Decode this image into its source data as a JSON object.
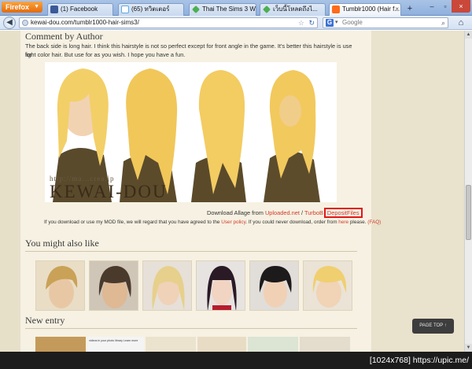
{
  "browser": {
    "menu_button": "Firefox",
    "tabs": [
      {
        "label": "(1) Facebook",
        "icon": "facebook-icon"
      },
      {
        "label": "(65) ทวิตเตอร์",
        "icon": "twitter-icon"
      },
      {
        "label": "Thai The Sims 3 W...",
        "icon": "sims-icon"
      },
      {
        "label": "เว็บนี้โหลดถึงไ...",
        "icon": "sims-icon"
      },
      {
        "label": "Tumblr1000 (Hair f...",
        "icon": "tumblr-icon",
        "active": true
      }
    ],
    "url": "kewai-dou.com/tumblr1000-hair-sims3/",
    "search_placeholder": "Google",
    "search_engine_letter": "G"
  },
  "article": {
    "heading": "Comment by Author",
    "body_line1": "The back side is long hair. I think this hairstyle is not so perfect except for front angle in the game. It's better this hairstyle is use for",
    "body_line2": "light color hair. But use for as you wish. I hope you have a fun.",
    "image_watermark_small": "http://ma...crea.jp",
    "image_watermark_big": "KEWAI-DOU",
    "download_prefix": "Download Allage from ",
    "download_link1": "Uploaded.net",
    "download_sep": " / ",
    "download_link2": "TurboB",
    "download_link3": "DepositFiles",
    "policy_prefix": "If you download or use my MOD file, we will regard that you have agreed to the ",
    "policy_link": "User policy",
    "policy_mid": ". If you could never download, order from ",
    "policy_here": "here",
    "policy_suffix": " please. ",
    "policy_faq": "(FAQ)"
  },
  "related": {
    "heading": "You might also like",
    "thumbnails": [
      "related-thumb-1",
      "related-thumb-2",
      "related-thumb-3",
      "related-thumb-4",
      "related-thumb-5",
      "related-thumb-6"
    ]
  },
  "new_entry": {
    "heading": "New entry",
    "snippet": "videos in your photo library  Learn more"
  },
  "page_top_label": "PAGE TOP ↑",
  "taskbar_label": "[1024x768] https://upic.me/",
  "colors": {
    "accent_link": "#d13b2a",
    "highlight_box": "#e0181a",
    "page_bg": "#efe9d6"
  }
}
